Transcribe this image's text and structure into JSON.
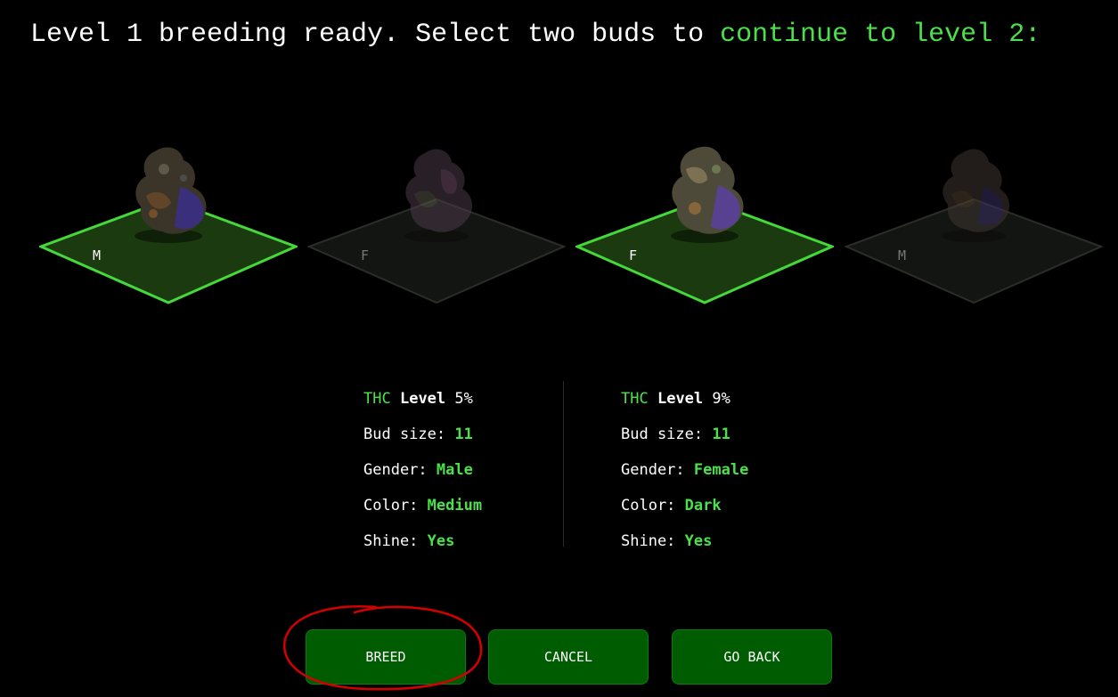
{
  "headline": {
    "part1": "Level 1 breeding ready. Select two buds to ",
    "part2": "continue to level 2:"
  },
  "tiles": [
    {
      "gender_letter": "M",
      "selected": true
    },
    {
      "gender_letter": "F",
      "selected": false
    },
    {
      "gender_letter": "F",
      "selected": true
    },
    {
      "gender_letter": "M",
      "selected": false
    }
  ],
  "stats": [
    {
      "thc_label": "THC",
      "level_label": "Level",
      "thc_value": "5%",
      "bud_size_label": "Bud size:",
      "bud_size_value": "11",
      "gender_label": "Gender:",
      "gender_value": "Male",
      "color_label": "Color:",
      "color_value": "Medium",
      "shine_label": "Shine:",
      "shine_value": "Yes"
    },
    {
      "thc_label": "THC",
      "level_label": "Level",
      "thc_value": "9%",
      "bud_size_label": "Bud size:",
      "bud_size_value": "11",
      "gender_label": "Gender:",
      "gender_value": "Female",
      "color_label": "Color:",
      "color_value": "Dark",
      "shine_label": "Shine:",
      "shine_value": "Yes"
    }
  ],
  "buttons": {
    "breed": "BREED",
    "cancel": "CANCEL",
    "go_back": "GO BACK"
  },
  "colors": {
    "accent": "#4be04b",
    "button_bg": "#005c00",
    "annotation": "#d40000"
  }
}
